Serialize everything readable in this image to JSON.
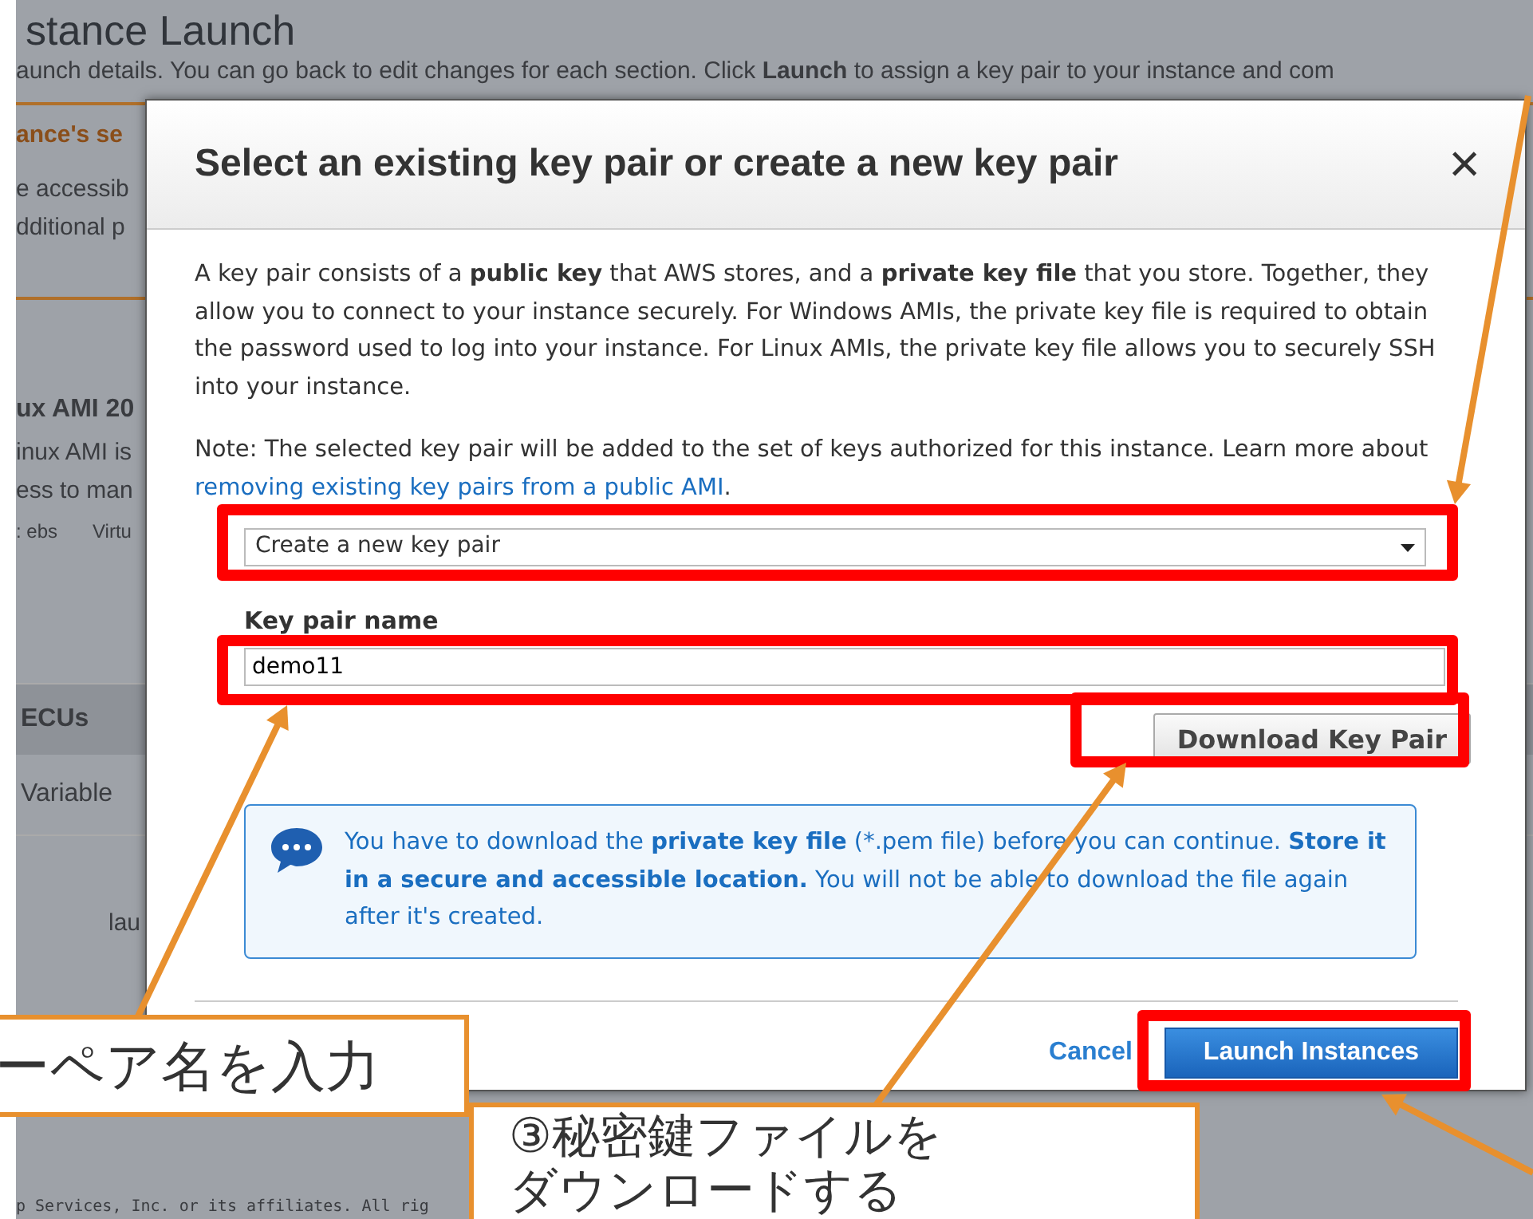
{
  "background": {
    "title": "stance Launch",
    "subtitle": "aunch details. You can go back to edit changes for each section. Click **Launch** to assign a key pair to your instance and com",
    "section_heading": "ance's se",
    "section_lines": [
      "e accessib",
      "dditional p"
    ],
    "ami_title": "ux AMI 20",
    "ami_lines": [
      "inux AMI is",
      "ess to man"
    ],
    "tags": [
      ": ebs",
      "Virtu"
    ],
    "table_header": "ECUs",
    "table_value": "Variable",
    "partial_text": "lau",
    "footer": "p Services, Inc. or its affiliates. All rig"
  },
  "dialog": {
    "title": "Select an existing key pair or create a new key pair",
    "close": "×",
    "description": "A key pair consists of a **public key** that AWS stores, and a **private key file** that you store. Together, they allow you to connect to your instance securely. For Windows AMIs, the private key file is required to obtain the password used to log into your instance. For Linux AMIs, the private key file allows you to securely SSH into your instance.",
    "note": "Note: The selected key pair will be added to the set of keys authorized for this instance. Learn more about",
    "note_link": "removing existing key pairs from a public AMI",
    "note_end": ".",
    "select_value": "Create a new key pair",
    "key_name_label": "Key pair name",
    "key_name_value": "demo11",
    "download_button": "Download Key Pair",
    "info_text": "You have to download the **private key file** (*.pem file) before you can continue. **Store it in a secure and accessible location.** You will not be able to download the file again after it's created.",
    "cancel": "Cancel",
    "launch": "Launch Instances"
  },
  "callouts": [
    {
      "lines": [
        "ーペア名を入力"
      ]
    },
    {
      "lines": [
        "③秘密鍵ファイルを",
        "ダウンロードする"
      ]
    }
  ]
}
